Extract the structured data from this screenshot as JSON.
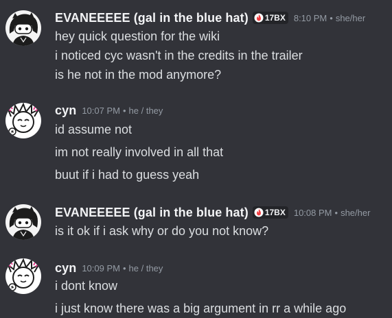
{
  "messages": [
    {
      "username": "EVANEEEEE (gal in the blue hat)",
      "badge": "17BX",
      "time": "8:10 PM",
      "pronouns": "she/her",
      "lines": [
        "hey quick question for the wiki",
        "i noticed cyc wasn't in the credits in the trailer",
        "is he not in the mod anymore?"
      ]
    },
    {
      "username": "cyn",
      "time": "10:07 PM",
      "pronouns": "he / they",
      "lines": [
        "id assume not",
        "im not really involved in all that",
        "buut if i had to guess yeah"
      ]
    },
    {
      "username": "EVANEEEEE (gal in the blue hat)",
      "badge": "17BX",
      "time": "10:08 PM",
      "pronouns": "she/her",
      "lines": [
        "is it ok if i ask why or do you not know?"
      ]
    },
    {
      "username": "cyn",
      "time": "10:09 PM",
      "pronouns": "he / they",
      "lines": [
        "i dont know",
        "i just know there was a big argument in rr a while ago"
      ]
    }
  ],
  "colors": {
    "background": "#323339",
    "username": "#f2f3f5",
    "message_text": "#dbdee1",
    "muted": "#949ba4",
    "badge_bg": "#232428",
    "badge_flame": "#f23f43",
    "cyn_accent": "#e63e8e"
  },
  "icons": {
    "evan_avatar": "dark-haired-character-avatar",
    "cyn_avatar": "spiky-sketch-character-avatar",
    "badge_icon": "flame-icon"
  }
}
